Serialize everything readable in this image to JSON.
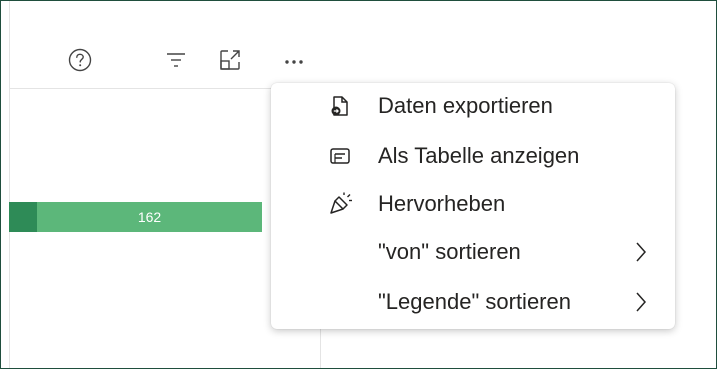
{
  "toolbar": {
    "help_icon": "question-circle-icon",
    "filter_icon": "filter-icon",
    "focus_icon": "focus-mode-icon",
    "more_icon": "more-options-icon"
  },
  "chart": {
    "bar_value_label": "162",
    "colors": {
      "dark_segment": "#2e8b57",
      "light_segment": "#5cb77a"
    }
  },
  "context_menu": {
    "items": [
      {
        "label": "Daten exportieren",
        "icon": "export-data-icon",
        "has_submenu": false
      },
      {
        "label": "Als Tabelle anzeigen",
        "icon": "show-as-table-icon",
        "has_submenu": false
      },
      {
        "label": "Hervorheben",
        "icon": "spotlight-icon",
        "has_submenu": false
      },
      {
        "label": "\"von\" sortieren",
        "icon": "",
        "has_submenu": true
      },
      {
        "label": "\"Legende\" sortieren",
        "icon": "",
        "has_submenu": true
      }
    ]
  },
  "colors": {
    "frame_border": "#1f4e3d",
    "text": "#252423"
  }
}
